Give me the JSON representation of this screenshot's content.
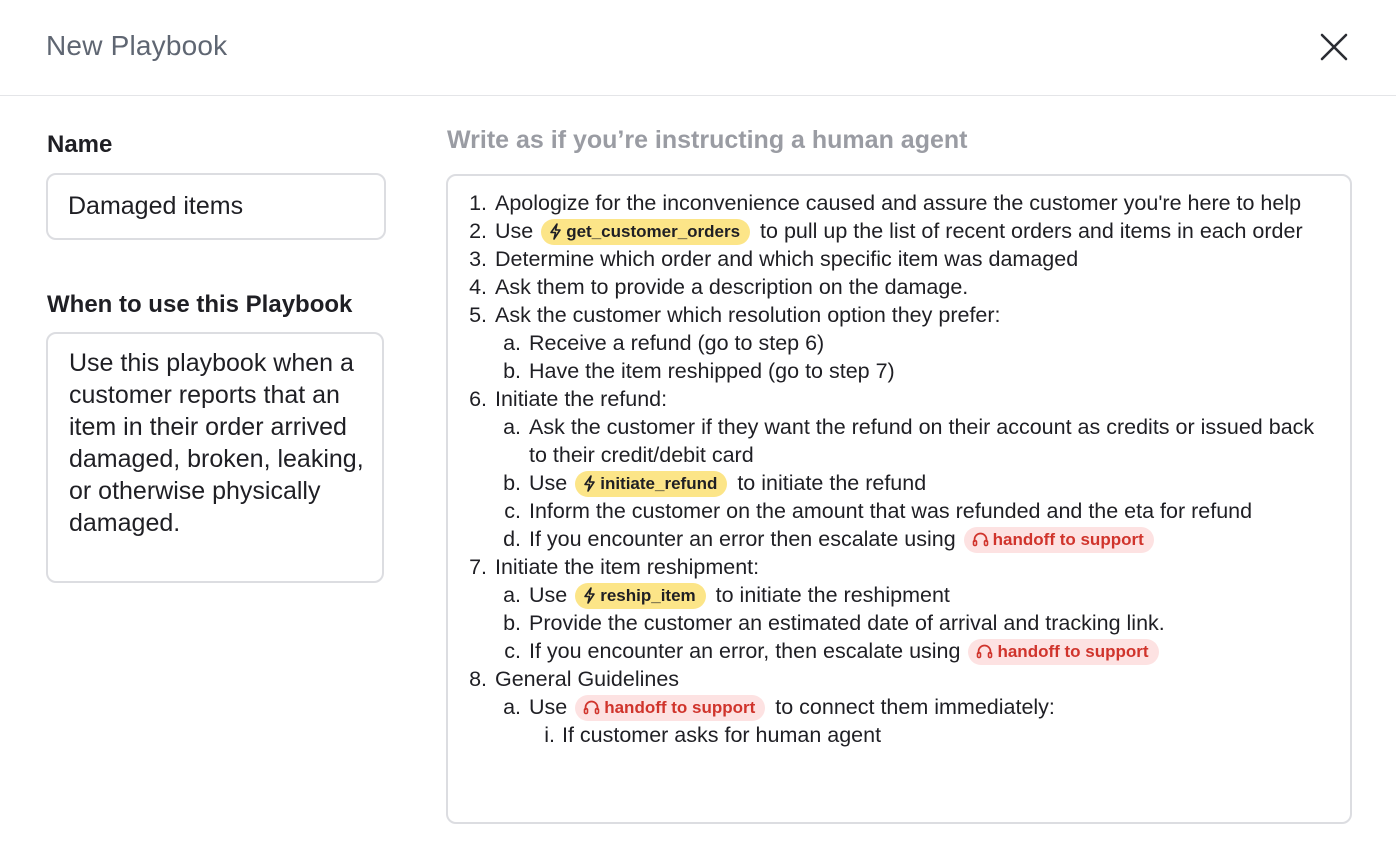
{
  "header": {
    "title": "New Playbook"
  },
  "name_section": {
    "label": "Name",
    "value": "Damaged items"
  },
  "when_section": {
    "label": "When to use this Playbook",
    "value": "Use this playbook when a customer reports that an item in their order arrived damaged, broken, leaking, or otherwise physically damaged."
  },
  "instructions": {
    "hint": "Write as if you’re instructing a human agent",
    "step1": {
      "num": "1.",
      "text": "Apologize for the inconvenience caused and assure the customer you're here to help"
    },
    "step2": {
      "num": "2.",
      "pre": "Use",
      "action": "get_customer_orders",
      "post": "to pull up the list of recent orders and items in each order"
    },
    "step3": {
      "num": "3.",
      "text": "Determine which order and which specific item was damaged"
    },
    "step4": {
      "num": "4.",
      "text": "Ask them to provide a description on the damage."
    },
    "step5": {
      "num": "5.",
      "text": "Ask the customer which resolution option they prefer:",
      "a": {
        "mark": "a.",
        "text": "Receive a refund (go to step 6)"
      },
      "b": {
        "mark": "b.",
        "text": "Have the item reshipped (go to step 7)"
      }
    },
    "step6": {
      "num": "6.",
      "text": "Initiate the refund:",
      "a": {
        "mark": "a.",
        "text": "Ask the customer if they want the refund on their account as credits or issued back to their credit/debit card"
      },
      "b": {
        "mark": "b.",
        "pre": "Use",
        "action": "initiate_refund",
        "post": "to initiate the refund"
      },
      "c": {
        "mark": "c.",
        "text": "Inform the customer on the amount that was refunded and the eta for refund"
      },
      "d": {
        "mark": "d.",
        "pre": "If you encounter an error then escalate using",
        "handoff": "handoff to support"
      }
    },
    "step7": {
      "num": "7.",
      "text": "Initiate the item reshipment:",
      "a": {
        "mark": "a.",
        "pre": "Use",
        "action": "reship_item",
        "post": "to initiate the reshipment"
      },
      "b": {
        "mark": "b.",
        "text": "Provide the customer an estimated date of arrival and tracking link."
      },
      "c": {
        "mark": "c.",
        "pre": "If you encounter an error, then escalate using",
        "handoff": "handoff to support"
      }
    },
    "step8": {
      "num": "8.",
      "text": "General Guidelines",
      "a": {
        "mark": "a.",
        "pre": "Use",
        "handoff": "handoff to support",
        "post": "to connect them immediately:"
      },
      "a_i": {
        "mark": "i.",
        "text": "If customer asks for human agent"
      }
    }
  },
  "colors": {
    "action_chip_bg": "#fce588",
    "handoff_chip_bg": "#fde2e2",
    "handoff_chip_text": "#d0342c",
    "title_text": "#5f6672",
    "hint_text": "#9a9ca3"
  },
  "icons": {
    "close": "close-icon",
    "action": "lightning-icon",
    "handoff": "headset-icon"
  }
}
